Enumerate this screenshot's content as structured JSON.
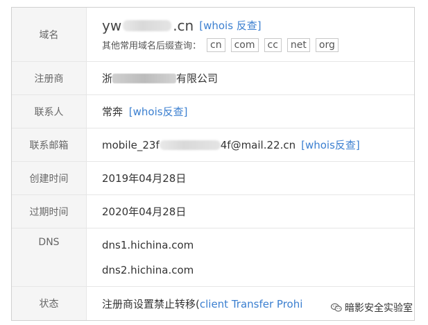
{
  "rows": {
    "domain": {
      "label": "域名",
      "prefix": "yw",
      "suffix": ".cn",
      "whois_link": "[whois 反查]",
      "suffix_query_label": "其他常用域名后缀查询：",
      "suffixes": [
        "cn",
        "com",
        "cc",
        "net",
        "org"
      ]
    },
    "registrar": {
      "label": "注册商",
      "prefix": "浙",
      "suffix": "有限公司"
    },
    "contact": {
      "label": "联系人",
      "value": "常奔",
      "whois_link": "[whois反查]"
    },
    "email": {
      "label": "联系邮箱",
      "prefix": "mobile_23f",
      "suffix": "4f@mail.22.cn",
      "whois_link": "[whois反查]"
    },
    "created": {
      "label": "创建时间",
      "value": "2019年04月28日"
    },
    "expires": {
      "label": "过期时间",
      "value": "2020年04月28日"
    },
    "dns": {
      "label": "DNS",
      "servers": [
        "dns1.hichina.com",
        "dns2.hichina.com"
      ]
    },
    "status": {
      "label": "状态",
      "value_text": "注册商设置禁止转移(",
      "value_link": "client Transfer Prohi"
    }
  },
  "watermark": {
    "text": "暗影安全实验室",
    "icon": "wechat-icon"
  },
  "colors": {
    "label_bg": "#f5f5f5",
    "link": "#3b7fd0",
    "border": "#e6e6e6"
  }
}
